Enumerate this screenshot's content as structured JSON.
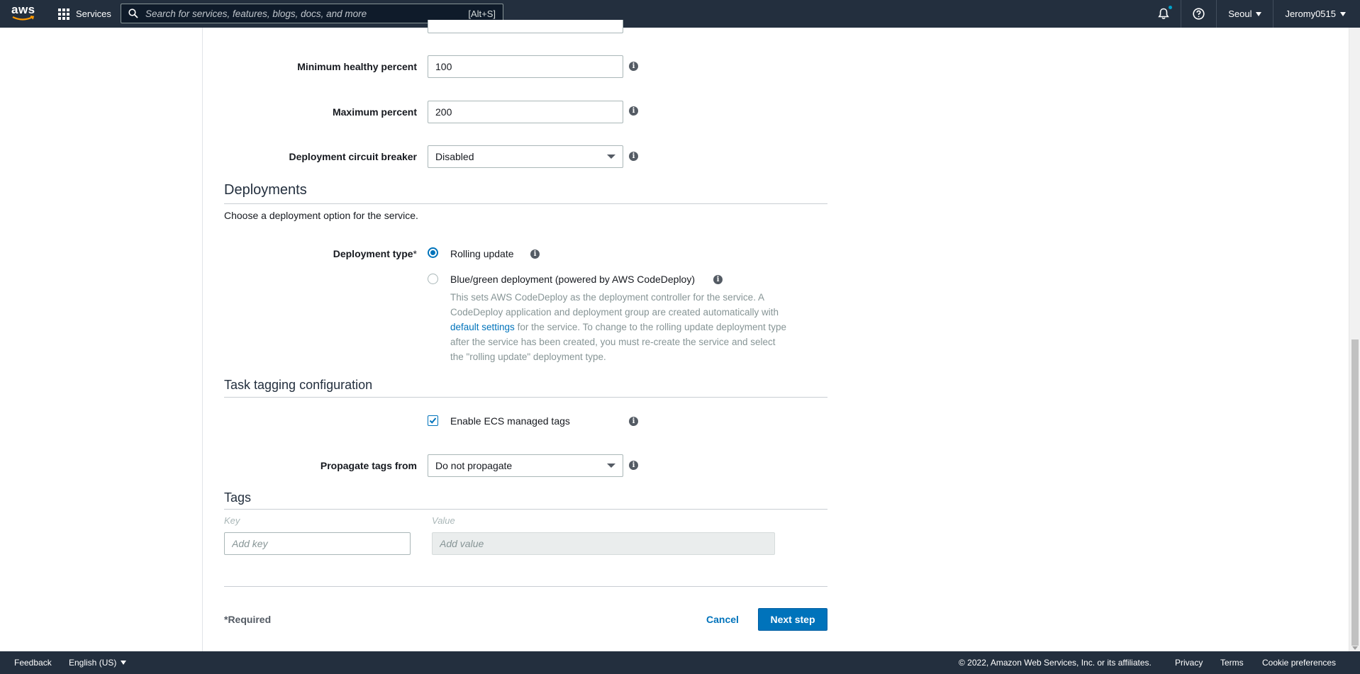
{
  "topnav": {
    "logo_text": "aws",
    "services_label": "Services",
    "search_placeholder": "Search for services, features, blogs, docs, and more",
    "search_shortcut": "[Alt+S]",
    "region": "Seoul",
    "account": "Jeromy0515"
  },
  "form": {
    "min_healthy_label": "Minimum healthy percent",
    "min_healthy_value": "100",
    "max_percent_label": "Maximum percent",
    "max_percent_value": "200",
    "circuit_breaker_label": "Deployment circuit breaker",
    "circuit_breaker_value": "Disabled"
  },
  "deployments": {
    "title": "Deployments",
    "description": "Choose a deployment option for the service.",
    "type_label": "Deployment type",
    "required_mark": "*",
    "option_rolling": "Rolling update",
    "option_bluegreen": "Blue/green deployment (powered by AWS CodeDeploy)",
    "help_part1": "This sets AWS CodeDeploy as the deployment controller for the service. A CodeDeploy application and deployment group are created automatically with ",
    "help_link": "default settings",
    "help_part2": " for the service. To change to the rolling update deployment type after the service has been created, you must re-create the service and select the \"rolling update\" deployment type."
  },
  "tagging": {
    "title": "Task tagging configuration",
    "enable_ecs_label": "Enable ECS managed tags",
    "propagate_label": "Propagate tags from",
    "propagate_value": "Do not propagate"
  },
  "tags": {
    "title": "Tags",
    "key_header": "Key",
    "value_header": "Value",
    "key_placeholder": "Add key",
    "value_placeholder": "Add value"
  },
  "actions": {
    "required_note": "*Required",
    "cancel": "Cancel",
    "next": "Next step"
  },
  "footer": {
    "feedback": "Feedback",
    "language": "English (US)",
    "copyright": "© 2022, Amazon Web Services, Inc. or its affiliates.",
    "privacy": "Privacy",
    "terms": "Terms",
    "cookie": "Cookie preferences"
  },
  "colors": {
    "nav_bg": "#232f3e",
    "primary": "#0073bb",
    "notification_dot": "#00a1c9"
  }
}
